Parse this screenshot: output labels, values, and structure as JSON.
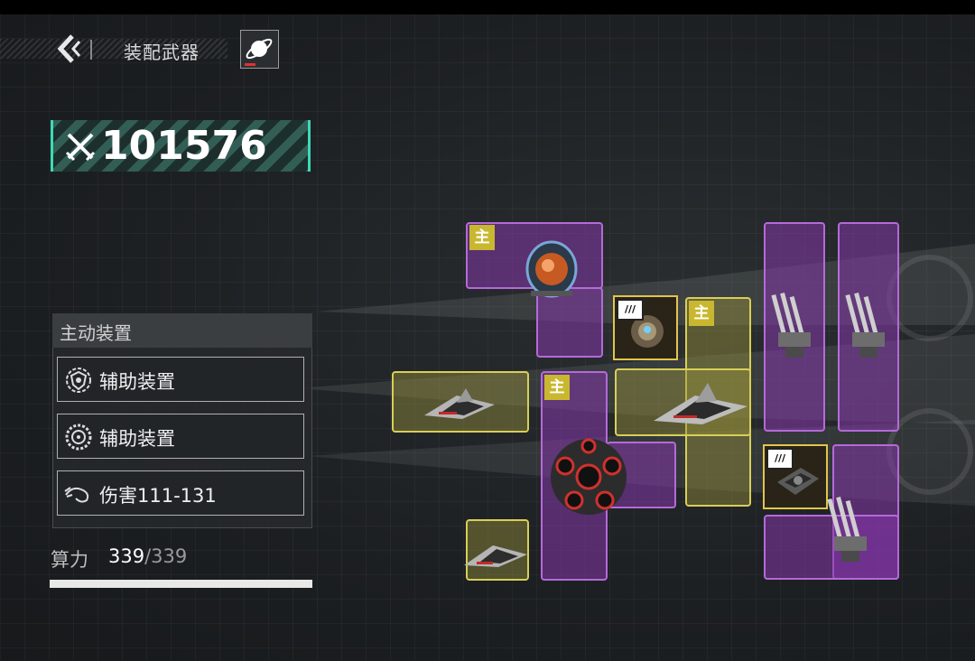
{
  "header": {
    "title": "装配武器",
    "back_icon": "chevron-left-icon",
    "planet_icon": "planet-icon"
  },
  "power": {
    "icon": "crossed-swords-icon",
    "value": "101576"
  },
  "slots": {
    "header": "主动装置",
    "items": [
      {
        "icon": "shield-gear-icon",
        "label": "辅助装置"
      },
      {
        "icon": "target-gear-icon",
        "label": "辅助装置"
      },
      {
        "icon": "damage-swirl-icon",
        "label": "伤害111-131"
      }
    ]
  },
  "compute": {
    "label": "算力",
    "current": "339",
    "max": "/339",
    "fill_fraction": 1.0
  },
  "grid": {
    "main_badge": "主",
    "tag_text": "///"
  },
  "colors": {
    "accent_teal": "#3fd9b6",
    "slot_purple": "#b56ad8",
    "slot_yellow": "#d8cf56",
    "badge_gold": "#c9b730"
  }
}
